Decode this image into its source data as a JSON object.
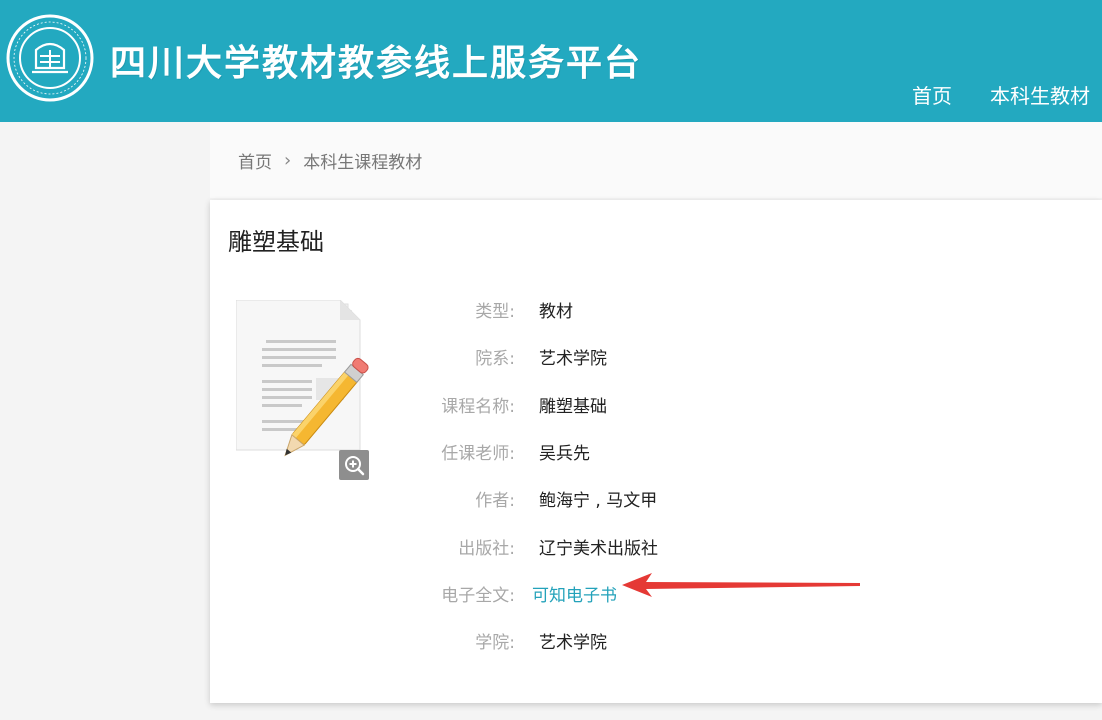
{
  "header": {
    "title": "四川大学教材教参线上服务平台",
    "logo_alt": "四川大学图书馆",
    "nav": [
      {
        "label": "首页"
      },
      {
        "label": "本科生教材"
      }
    ]
  },
  "breadcrumb": {
    "home": "首页",
    "current": "本科生课程教材"
  },
  "book": {
    "title": "雕塑基础",
    "fields": [
      {
        "label": "类型:",
        "value": "教材"
      },
      {
        "label": "院系:",
        "value": "艺术学院"
      },
      {
        "label": "课程名称:",
        "value": "雕塑基础"
      },
      {
        "label": "任课老师:",
        "value": "吴兵先"
      },
      {
        "label": "作者:",
        "value": "鲍海宁 , 马文甲"
      },
      {
        "label": "出版社:",
        "value": "辽宁美术出版社"
      },
      {
        "label": "电子全文:",
        "link": "可知电子书"
      },
      {
        "label": "学院:",
        "value": "艺术学院"
      }
    ]
  },
  "colors": {
    "header_bg": "#23a9c0",
    "link": "#23a2ba",
    "annotation_arrow": "#e53935"
  },
  "icons": {
    "logo": "university-seal-icon",
    "cover": "document-with-pencil-icon",
    "zoom": "zoom-in-icon",
    "annotation": "red-arrow-annotation"
  }
}
